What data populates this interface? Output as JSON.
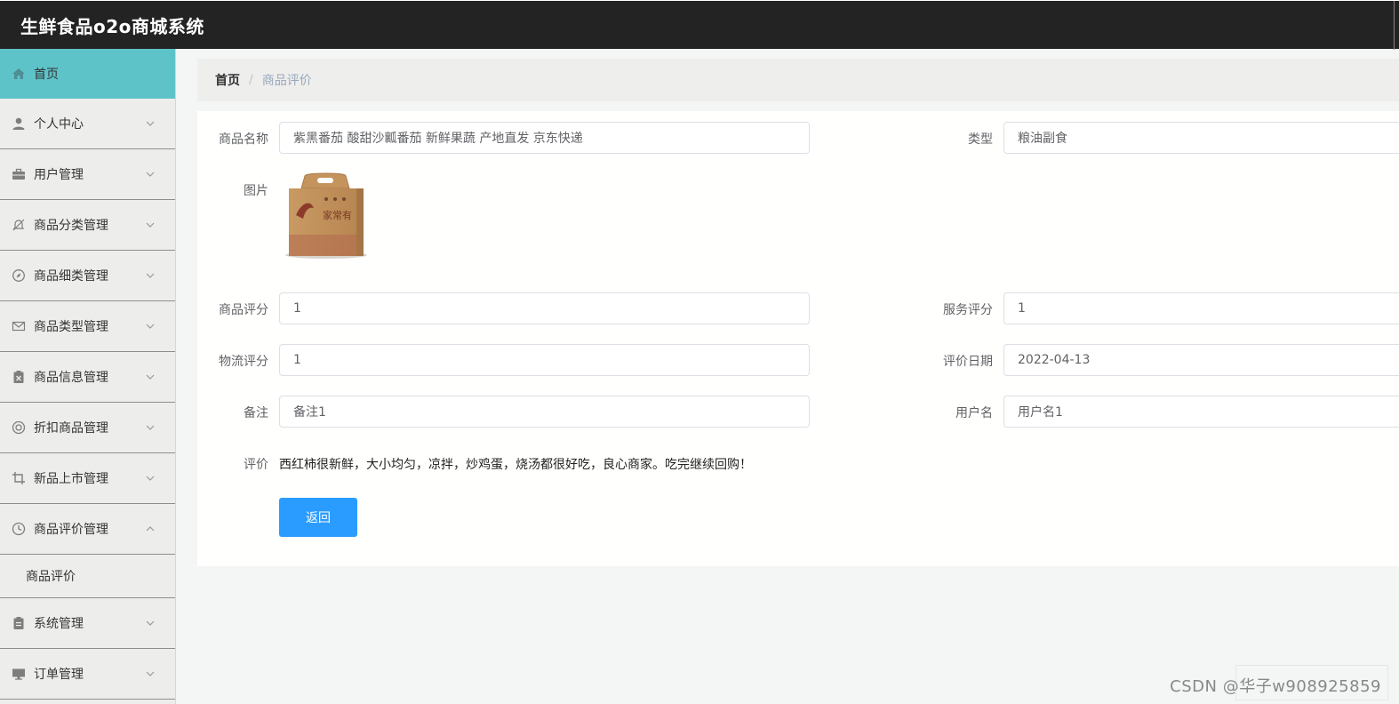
{
  "app": {
    "title": "生鲜食品o2o商城系统"
  },
  "sidebar": {
    "items": [
      {
        "label": "首页",
        "icon": "home-icon",
        "active": true
      },
      {
        "label": "个人中心",
        "icon": "user-icon"
      },
      {
        "label": "用户管理",
        "icon": "briefcase-icon"
      },
      {
        "label": "商品分类管理",
        "icon": "bell-off-icon"
      },
      {
        "label": "商品细类管理",
        "icon": "compass-icon"
      },
      {
        "label": "商品类型管理",
        "icon": "mail-icon"
      },
      {
        "label": "商品信息管理",
        "icon": "clipboard-x-icon"
      },
      {
        "label": "折扣商品管理",
        "icon": "lifebuoy-icon"
      },
      {
        "label": "新品上市管理",
        "icon": "crop-icon"
      },
      {
        "label": "商品评价管理",
        "icon": "clock-icon",
        "expanded": true
      }
    ],
    "sub_item": "商品评价",
    "bottom_items": [
      {
        "label": "系统管理",
        "icon": "clipboard-icon"
      },
      {
        "label": "订单管理",
        "icon": "monitor-icon"
      }
    ]
  },
  "breadcrumb": {
    "home": "首页",
    "separator": "/",
    "current": "商品评价"
  },
  "form": {
    "product_name": {
      "label": "商品名称",
      "value": "紫黑番茄 酸甜沙瓤番茄 新鲜果蔬 产地直发 京东快递"
    },
    "type": {
      "label": "类型",
      "value": "粮油副食"
    },
    "image": {
      "label": "图片",
      "box_text": "家常有"
    },
    "product_rating": {
      "label": "商品评分",
      "value": "1"
    },
    "service_rating": {
      "label": "服务评分",
      "value": "1"
    },
    "logistics_rating": {
      "label": "物流评分",
      "value": "1"
    },
    "review_date": {
      "label": "评价日期",
      "value": "2022-04-13"
    },
    "remark": {
      "label": "备注",
      "value": "备注1"
    },
    "username": {
      "label": "用户名",
      "value": "用户名1"
    },
    "review": {
      "label": "评价",
      "value": "西红柿很新鲜，大小均匀，凉拌，炒鸡蛋，烧汤都很好吃，良心商家。吃完继续回购！"
    },
    "back_button": "返回"
  },
  "watermark": "CSDN @华子w908925859"
}
